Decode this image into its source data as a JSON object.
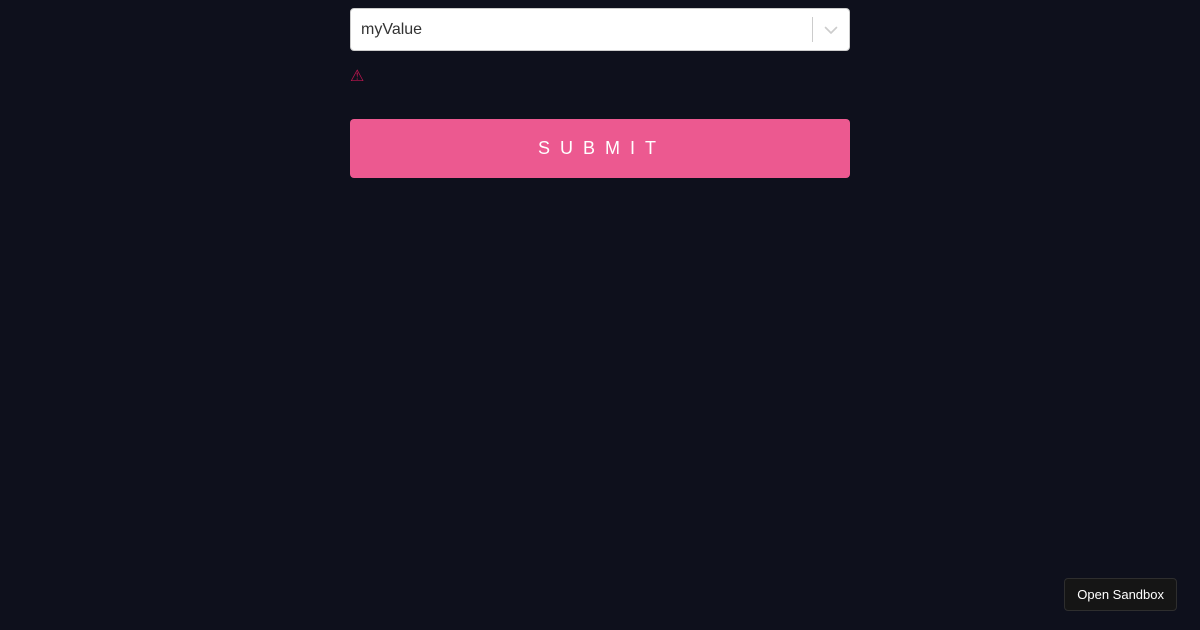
{
  "form": {
    "select": {
      "value": "myValue",
      "indicator_icon": "chevron-down-icon"
    },
    "error": {
      "icon": "warning-icon",
      "symbol": "⚠",
      "color": "#bf1650"
    },
    "submit_label": "submit",
    "submit_color": "#ec5990"
  },
  "sandbox": {
    "label": "Open Sandbox"
  },
  "theme": {
    "background": "#0e101c"
  }
}
